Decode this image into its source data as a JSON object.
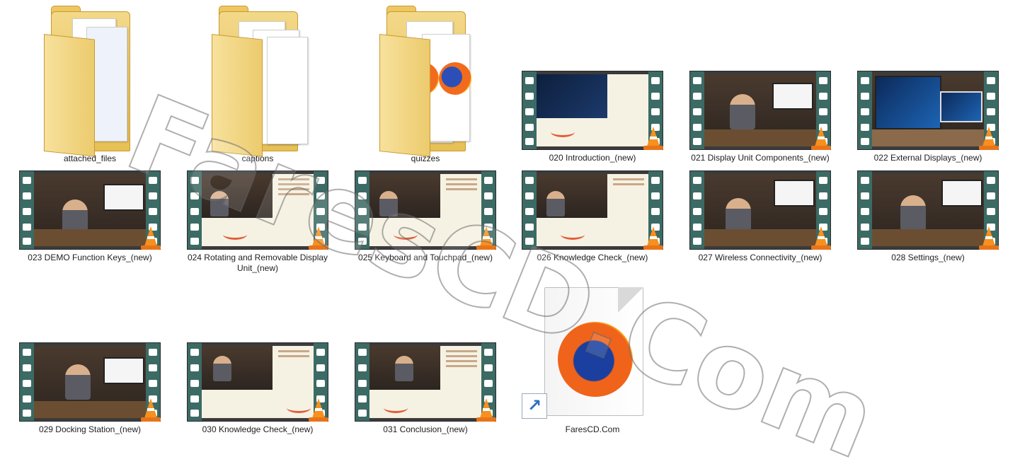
{
  "items": [
    {
      "label": "attached_files",
      "type": "folder"
    },
    {
      "label": "captions",
      "type": "folder"
    },
    {
      "label": "quizzes",
      "type": "folder"
    },
    {
      "label": "020 Introduction_(new)",
      "type": "video"
    },
    {
      "label": "021 Display Unit Components_(new)",
      "type": "video"
    },
    {
      "label": "022 External Displays_(new)",
      "type": "video"
    },
    {
      "label": "023 DEMO Function Keys_(new)",
      "type": "video"
    },
    {
      "label": "024 Rotating and Removable Display Unit_(new)",
      "type": "video"
    },
    {
      "label": "025 Keyboard and Touchpad_(new)",
      "type": "video"
    },
    {
      "label": "026 Knowledge Check_(new)",
      "type": "video"
    },
    {
      "label": "027 Wireless Connectivity_(new)",
      "type": "video"
    },
    {
      "label": "028 Settings_(new)",
      "type": "video"
    },
    {
      "label": "029 Docking Station_(new)",
      "type": "video"
    },
    {
      "label": "030 Knowledge Check_(new)",
      "type": "video"
    },
    {
      "label": "031 Conclusion_(new)",
      "type": "video"
    },
    {
      "label": "FaresCD.Com",
      "type": "shortcut"
    }
  ],
  "icons": {
    "folder": "folder-icon",
    "video": "vlc-video-thumbnail-icon",
    "shortcut": "firefox-shortcut-icon"
  },
  "watermark": "FaresCD.Com",
  "colors": {
    "background": "#ffffff",
    "folder": "#e7bf55",
    "vlc_cone": "#f7901e",
    "film_strip": "#3c6a64"
  }
}
